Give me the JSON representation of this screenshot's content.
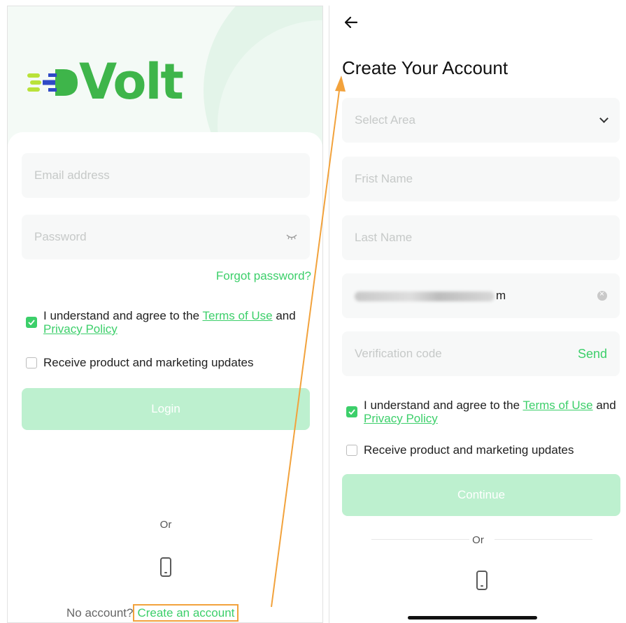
{
  "login_screen": {
    "logo_text": "Volt",
    "email_placeholder": "Email address",
    "password_placeholder": "Password",
    "forgot_password": "Forgot password?",
    "terms_prefix": "I understand and agree to the ",
    "terms_link": "Terms of Use",
    "terms_and": " and ",
    "privacy_link": "Privacy Policy",
    "marketing_label": "Receive product and marketing updates",
    "login_button": "Login",
    "or_label": "Or",
    "no_account": "No account?",
    "create_account": "Create an account",
    "terms_checked": true,
    "marketing_checked": false
  },
  "signup_screen": {
    "back_icon": "arrow-left-icon",
    "title": "Create Your Account",
    "area_placeholder": "Select Area",
    "first_name_placeholder": "Frist Name",
    "last_name_placeholder": "Last Name",
    "email_value_suffix": "m",
    "verification_placeholder": "Verification code",
    "send_label": "Send",
    "terms_prefix": "I understand and agree to the ",
    "terms_link": "Terms of Use",
    "terms_and": " and ",
    "privacy_link": "Privacy Policy",
    "marketing_label": "Receive product and marketing updates",
    "continue_button": "Continue",
    "or_label": "Or",
    "terms_checked": true,
    "marketing_checked": false
  },
  "colors": {
    "accent": "#3ccf6a",
    "button_disabled": "#bdf0cf",
    "annotation": "#f2a23c",
    "logo_green": "#3eb54a",
    "logo_blue": "#2f49c6"
  }
}
